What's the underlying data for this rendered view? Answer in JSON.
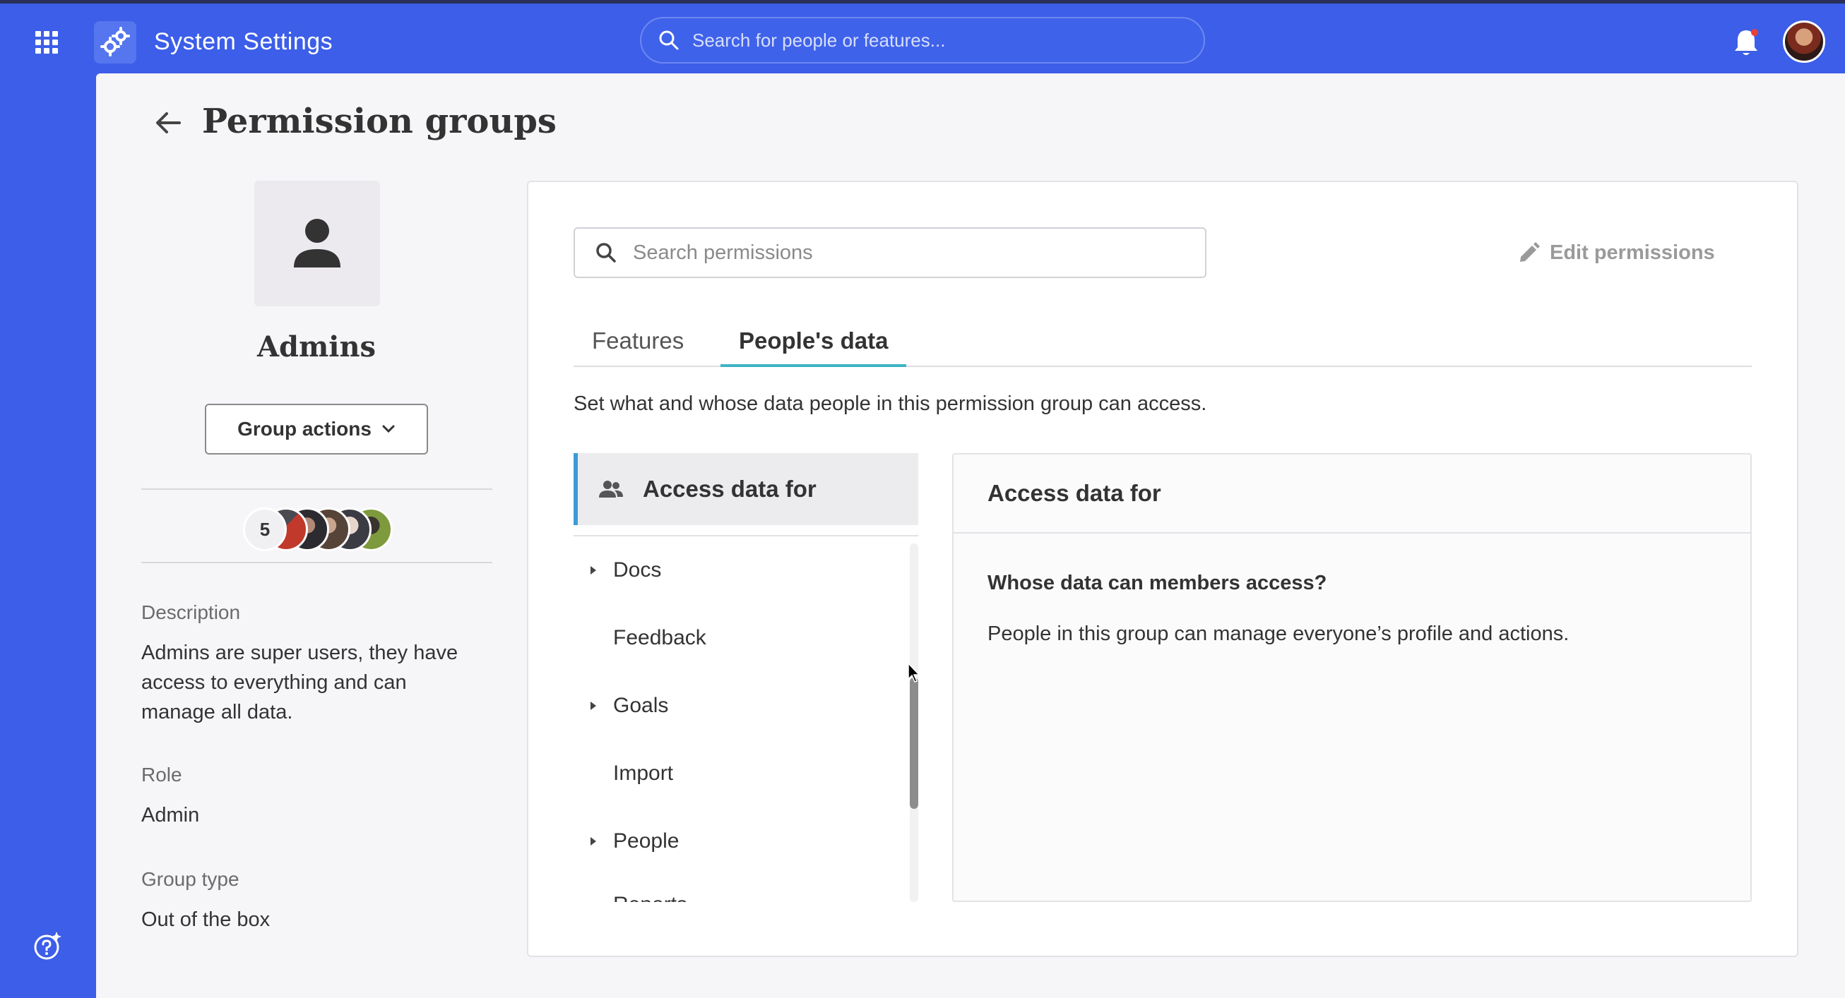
{
  "app": {
    "title": "System Settings",
    "search_placeholder": "Search for people or features..."
  },
  "page": {
    "title": "Permission groups"
  },
  "group": {
    "name": "Admins",
    "actions_label": "Group actions",
    "member_count": "5",
    "description_label": "Description",
    "description": "Admins are super users, they have access to everything and can manage all data.",
    "role_label": "Role",
    "role": "Admin",
    "type_label": "Group type",
    "type": "Out of the box"
  },
  "permissions": {
    "search_placeholder": "Search permissions",
    "edit_label": "Edit permissions",
    "tabs": [
      {
        "label": "Features",
        "active": false
      },
      {
        "label": "People's data",
        "active": true
      }
    ],
    "tab_description": "Set what and whose data people in this permission group can access.",
    "selected_category": "Access data for",
    "categories": [
      {
        "label": "Docs",
        "expandable": true
      },
      {
        "label": "Feedback",
        "expandable": false
      },
      {
        "label": "Goals",
        "expandable": true
      },
      {
        "label": "Import",
        "expandable": false
      },
      {
        "label": "People",
        "expandable": true
      },
      {
        "label": "Reports",
        "expandable": false
      }
    ],
    "detail": {
      "title": "Access data for",
      "question": "Whose data can members access?",
      "answer": "People in this group can manage everyone’s profile and actions."
    }
  },
  "colors": {
    "brand": "#3c5ee8",
    "active_tab": "#3cb4c4",
    "selected_accent": "#3c9bd8"
  },
  "icons": [
    "apps-grid-icon",
    "settings-gears-icon",
    "search-icon",
    "bell-icon",
    "back-arrow-icon",
    "person-icon",
    "chevron-down-icon",
    "pencil-icon",
    "people-icon",
    "caret-right-icon",
    "help-sparkle-icon"
  ]
}
